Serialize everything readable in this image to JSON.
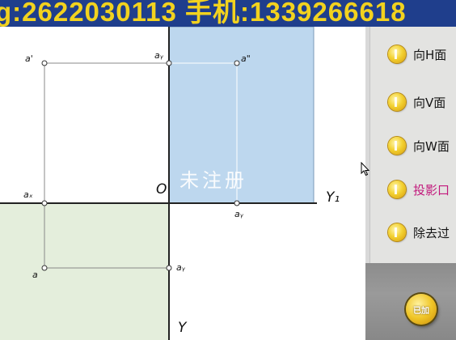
{
  "banner": {
    "text": "g:2622030113  手机:1339266618"
  },
  "drawing": {
    "labels": {
      "a_prime": "a'",
      "a_x": "aₓ",
      "a_bottom": "a",
      "a_yw_top": "aᵧ",
      "a_dbl": "a\"",
      "a_yh": "aᵧ",
      "a_yw_side": "aᵧ",
      "origin": "O",
      "y1": "Y₁",
      "y": "Y"
    },
    "watermark": "未注册",
    "colors": {
      "v_region": "#bdd7ee",
      "h_region": "#e4eedc",
      "axis": "#222222"
    }
  },
  "panel": {
    "buttons": [
      {
        "label": "向H面",
        "active": false
      },
      {
        "label": "向V面",
        "active": false
      },
      {
        "label": "向W面",
        "active": false
      },
      {
        "label": "投影口",
        "active": true
      },
      {
        "label": "除去过",
        "active": false
      }
    ],
    "round_button": "已加"
  }
}
